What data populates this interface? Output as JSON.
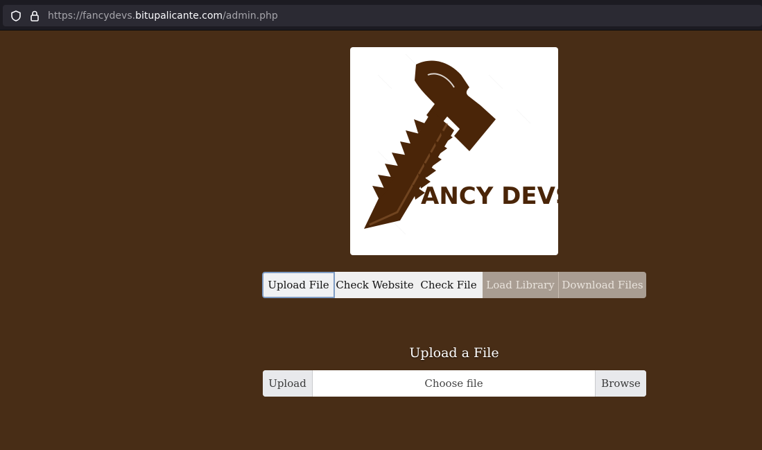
{
  "browser": {
    "url_prefix": "https://fancydevs.",
    "url_domain": "bitupalicante.com",
    "url_path": "/admin.php"
  },
  "logo": {
    "text": "ANCY DEVS",
    "color": "#4a2508"
  },
  "tabs": [
    {
      "label": "Upload File",
      "state": "active"
    },
    {
      "label": "Check Website",
      "state": "enabled"
    },
    {
      "label": "Check File",
      "state": "enabled"
    },
    {
      "label": "Load Library",
      "state": "disabled"
    },
    {
      "label": "Download Files",
      "state": "disabled"
    }
  ],
  "upload": {
    "title": "Upload a File",
    "upload_button": "Upload",
    "file_placeholder": "Choose file",
    "browse_button": "Browse"
  },
  "colors": {
    "page_background": "#482d16",
    "disabled_tab": "#a99d92"
  }
}
